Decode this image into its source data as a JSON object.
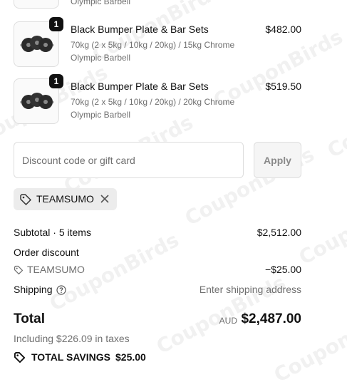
{
  "top_partial": {
    "variant_tail": "Olympic Barbell"
  },
  "items": [
    {
      "quantity": "1",
      "name": "Black Bumper Plate & Bar Sets",
      "variant_line1": "70kg (2 x 5kg / 10kg / 20kg) / 15kg Chrome",
      "variant_line2": "Olympic Barbell",
      "price": "$482.00",
      "icon": "barbell-plates-image"
    },
    {
      "quantity": "1",
      "name": "Black Bumper Plate & Bar Sets",
      "variant_line1": "70kg (2 x 5kg / 10kg / 20kg) / 20kg Chrome",
      "variant_line2": "Olympic Barbell",
      "price": "$519.50",
      "icon": "barbell-plates-image"
    }
  ],
  "discount": {
    "placeholder": "Discount code or gift card",
    "apply_label": "Apply",
    "applied_code": "TEAMSUMO"
  },
  "summary": {
    "subtotal_label": "Subtotal · 5 items",
    "subtotal_value": "$2,512.00",
    "order_discount_label": "Order discount",
    "discount_code": "TEAMSUMO",
    "discount_value": "−$25.00",
    "shipping_label": "Shipping",
    "shipping_value": "Enter shipping address",
    "total_label": "Total",
    "currency": "AUD",
    "total_value": "$2,487.00",
    "tax_note": "Including $226.09 in taxes",
    "savings_label": "TOTAL SAVINGS",
    "savings_value": "$25.00"
  },
  "watermark": "CouponBirds",
  "colors": {
    "text": "#111111",
    "muted": "#707070",
    "border": "#dedede",
    "chip_bg": "#ececec"
  }
}
